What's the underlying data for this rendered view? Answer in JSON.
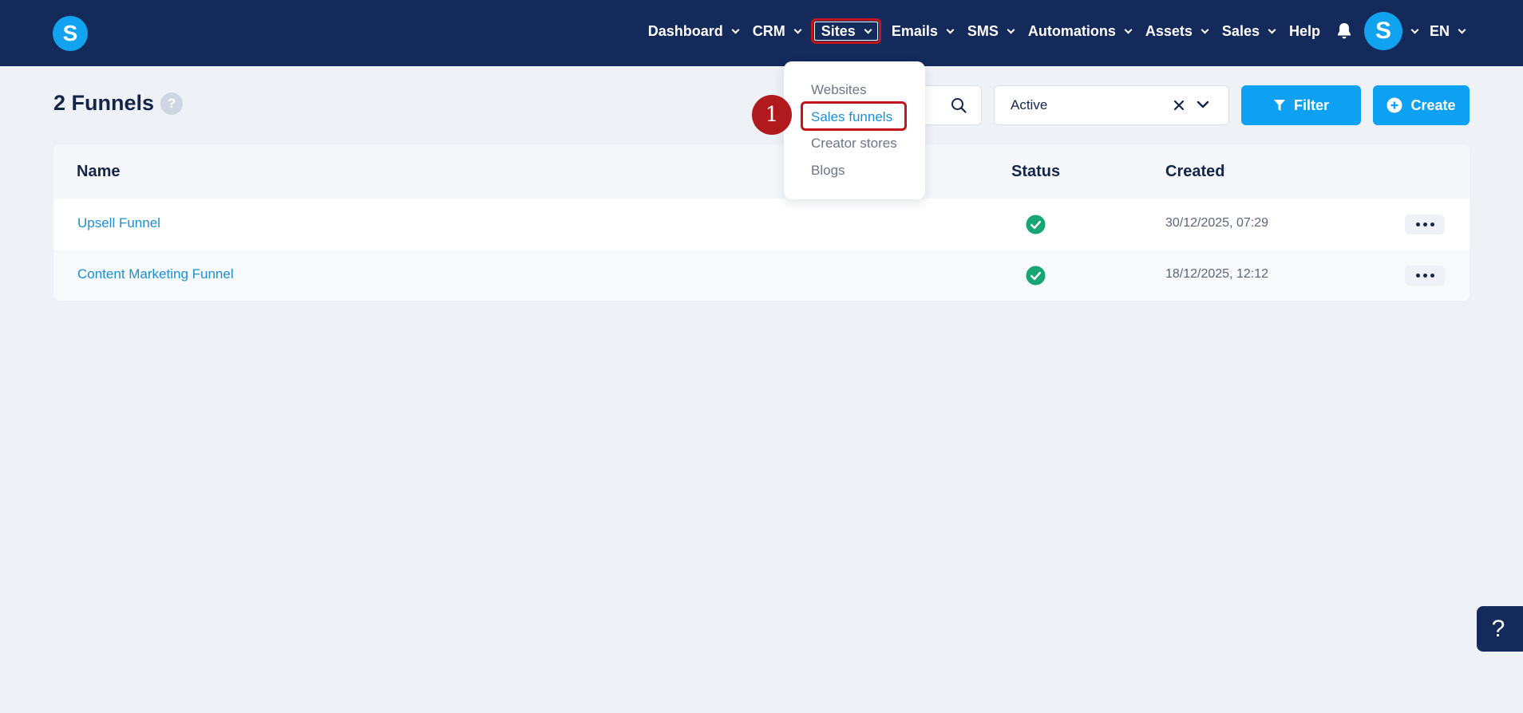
{
  "app": {
    "logo_letter": "S"
  },
  "nav": {
    "items": [
      {
        "label": "Dashboard"
      },
      {
        "label": "CRM"
      },
      {
        "label": "Sites"
      },
      {
        "label": "Emails"
      },
      {
        "label": "SMS"
      },
      {
        "label": "Automations"
      },
      {
        "label": "Assets"
      },
      {
        "label": "Sales"
      },
      {
        "label": "Help"
      }
    ],
    "avatar_letter": "S",
    "language": "EN"
  },
  "page": {
    "title": "2 Funnels",
    "help_symbol": "?"
  },
  "toolbar": {
    "status_value": "Active",
    "filter_label": "Filter",
    "create_label": "Create"
  },
  "table": {
    "headers": {
      "name": "Name",
      "status": "Status",
      "created": "Created"
    },
    "rows": [
      {
        "name": "Upsell Funnel",
        "status": "active",
        "created": "30/12/2025, 07:29"
      },
      {
        "name": "Content Marketing Funnel",
        "status": "active",
        "created": "18/12/2025, 12:12"
      }
    ]
  },
  "dropdown": {
    "items": [
      {
        "label": "Websites"
      },
      {
        "label": "Sales funnels"
      },
      {
        "label": "Creator stores"
      },
      {
        "label": "Blogs"
      }
    ]
  },
  "annotation": {
    "step": "1"
  },
  "help_fab": {
    "symbol": "?"
  },
  "colors": {
    "header_bg": "#142a5b",
    "accent": "#0ea0f2",
    "highlight": "#c3161c",
    "success": "#17a673"
  }
}
